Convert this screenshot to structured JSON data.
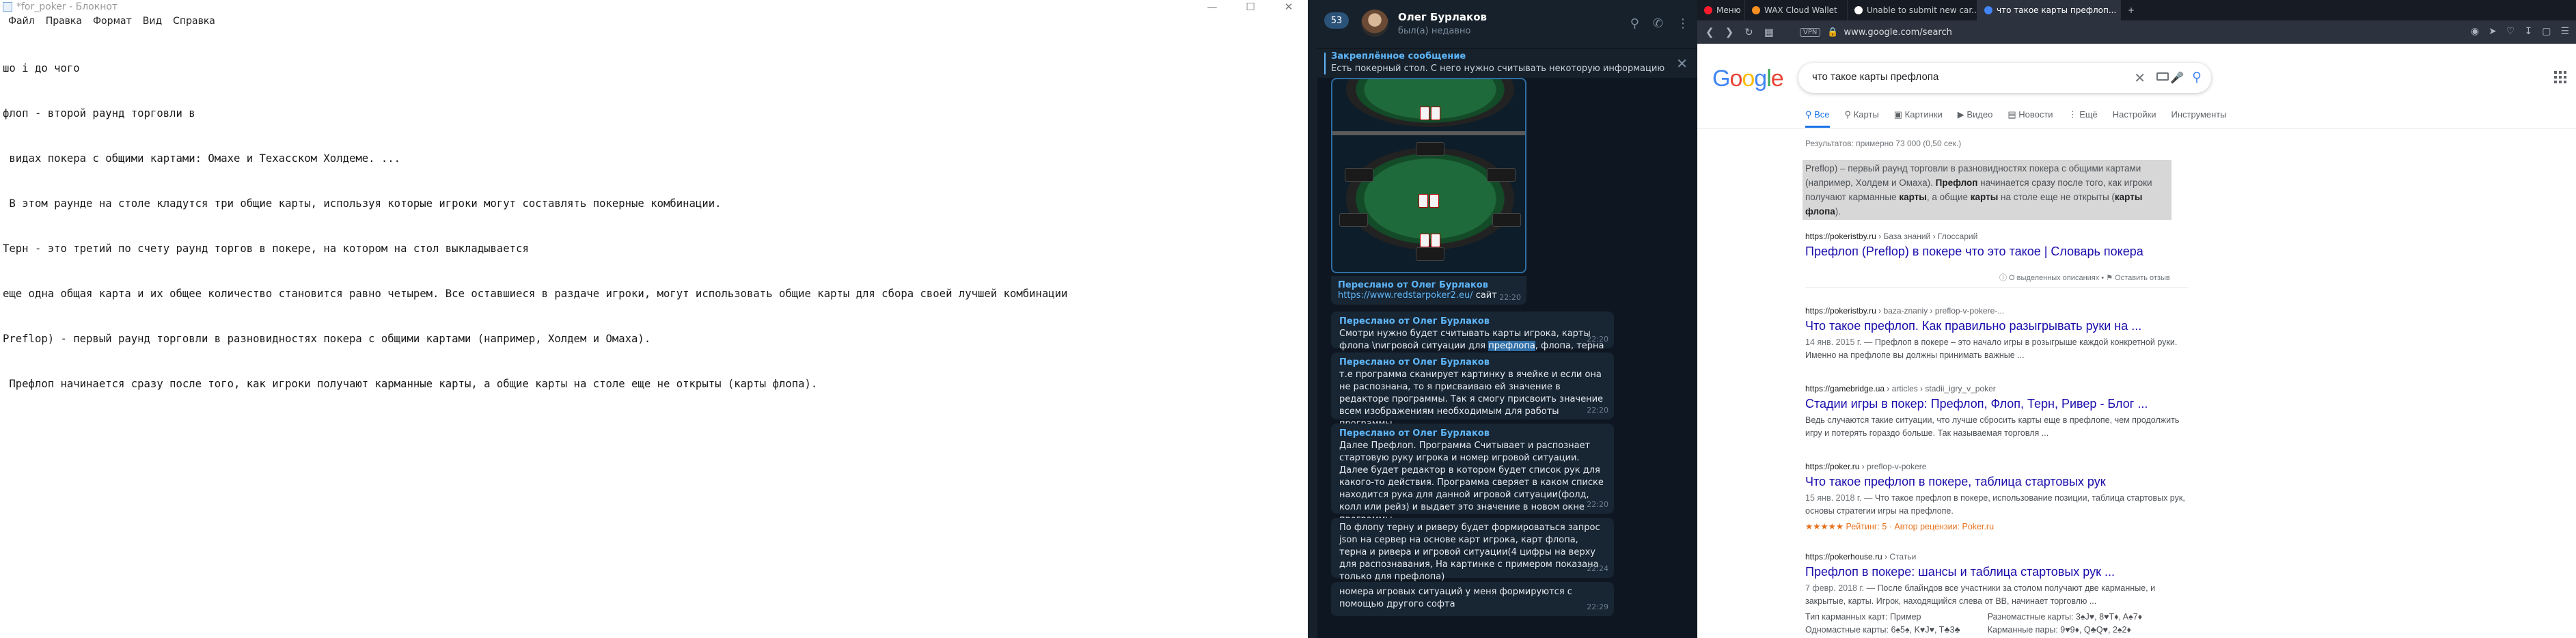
{
  "notepad": {
    "title": "*for_poker - Блокнот",
    "controls": [
      "—",
      "☐",
      "✕"
    ],
    "menu": [
      "Файл",
      "Правка",
      "Формат",
      "Вид",
      "Справка"
    ],
    "lines": [
      "шо і до чого",
      "флоп - второй раунд торговли в",
      " видах покера с общими картами: Омахе и Техасском Холдеме. ...",
      " В этом раунде на столе кладутся три общие карты, используя которые игроки могут составлять покерные комбинации.",
      "Терн - это третий по счету раунд торгов в покере, на котором на стол выкладывается",
      "еще одна общая карта и их общее количество становится равно четырем. Все оставшиеся в раздаче игроки, могут использовать общие карты для сбора своей лучшей комбинации",
      "Preflop) - первый раунд торговли в разновидностях покера с общими картами (например, Холдем и Омаха).",
      " Префлоп начинается сразу после того, как игроки получают карманные карты, а общие карты на столе еще не открыты (карты флопа)."
    ]
  },
  "telegram": {
    "back_count": "53",
    "contact_name": "Олег Бурлаков",
    "contact_status": "был(а) недавно",
    "header_icons": [
      "search-icon",
      "phone-icon",
      "more-icon"
    ],
    "pinned": {
      "title": "Закреплённое сообщение",
      "text": "Есть покерный стол. С него нужно считывать некоторую информацию"
    },
    "image_caption": {
      "forwarded": "Переслано от Олег Бурлаков",
      "link": "https://www.redstarpoker2.eu/",
      "suffix": " сайт",
      "time": "22:20"
    },
    "messages": [
      {
        "forwarded": "Переслано от Олег Бурлаков",
        "pre": "Смотри нужно будет считывать карты игрока, карты флопа \\nигровой ситуации для ",
        "highlight": "префлопа",
        "post": ", флопа, терна и ривера",
        "time": "22:20"
      },
      {
        "forwarded": "Переслано от Олег Бурлаков",
        "text": "т.е программа сканирует картинку в ячейке и если она не распознана, то я присваиваю ей значение в редакторе программы. Так я смогу присвоить значение всем изображениям необходимым для работы программы.",
        "time": "22:20"
      },
      {
        "forwarded": "Переслано от Олег Бурлаков",
        "text": "Далее Префлоп. Программа Считывает и распознает стартовую руку игрока и номер игровой ситуации. Далее будет редактор в котором будет список рук для какого-то действия. Программа сверяет в каком списке находится рука для данной игровой ситуации(фолд, колл или рейз) и выдает это значение в новом окне программы.",
        "time": "22:20"
      },
      {
        "text": "По флопу терну и риверу будет формироваться запрос json на сервер на основе карт игрока, карт флопа, терна и ривера и игровой ситуации(4 цифры на верху для распознавания, На картинке с примером показана только для префлопа)",
        "time": "22:24"
      },
      {
        "text": "номера игровых ситуаций у меня формируются с помощью другого софта",
        "time": "22:29"
      }
    ]
  },
  "browser": {
    "tabs": [
      {
        "label": "Меню",
        "icon_color": "#ff1b2d"
      },
      {
        "label": "WAX Cloud Wallet",
        "icon_color": "#f89022"
      },
      {
        "label": "Unable to submit new car...",
        "icon_color": "#ffffff"
      },
      {
        "label": "что такое карты префлоп...",
        "icon_color": "#4285f4"
      }
    ],
    "new_tab": "+",
    "url": "www.google.com/search",
    "vpn_label": "VPN",
    "google": {
      "logo_letters": [
        {
          "ch": "G",
          "color": "#4285f4"
        },
        {
          "ch": "o",
          "color": "#ea4335"
        },
        {
          "ch": "o",
          "color": "#fbbc05"
        },
        {
          "ch": "g",
          "color": "#4285f4"
        },
        {
          "ch": "l",
          "color": "#34a853"
        },
        {
          "ch": "e",
          "color": "#ea4335"
        }
      ],
      "query": "что такое карты префлопа",
      "tabs": [
        "Все",
        "Карты",
        "Картинки",
        "Видео",
        "Новости",
        "Ещё",
        "Настройки",
        "Инструменты"
      ],
      "stats": "Результатов: примерно 73 000 (0,50 сек.)",
      "snippet": {
        "p1": "Preflop) – первый раунд торговли в разновидностях покера с общими картами (например, Холдем и Омаха). ",
        "b1": "Префлоп",
        "p2": " начинается сразу после того, как игроки получают карманные ",
        "b2": "карты",
        "p3": ", а общие ",
        "b3": "карты",
        "p4": " на столе еще не открыты (",
        "b4": "карты флопа",
        "p5": ")."
      },
      "featured": {
        "cite": "https://pokeristby.ru",
        "crumbs": " › База знаний › Глоссарий",
        "title": "Префлоп (Preflop) в покере что это такое | Словарь покера"
      },
      "feedback": "ⓘ О выделенных описаниях  •  ⚑ Оставить отзыв",
      "results": [
        {
          "cite": "https://pokeristby.ru",
          "crumbs": " › baza-znaniy › preflop-v-pokere-...",
          "title": "Что такое префлоп. Как правильно разыгрывать руки на ...",
          "date": "14 янв. 2015 г. — ",
          "desc": "Префлоп в покере – это начало игры в розыгрыше каждой конкретной руки. Именно на префлопе вы должны принимать важные ..."
        },
        {
          "cite": "https://gamebridge.ua",
          "crumbs": " › articles › stadii_igry_v_poker",
          "title": "Стадии игры в покер: Префлоп, Флоп, Терн, Ривер - Блог ...",
          "date": "",
          "desc": "Ведь случаются такие ситуации, что лучше сбросить карты еще в префлопе, чем продолжить игру и потерять гораздо больше. Так называемая торговля ..."
        },
        {
          "cite": "https://poker.ru",
          "crumbs": " › preflop-v-pokere",
          "title": "Что такое префлоп в покере, таблица стартовых рук",
          "date": "15 янв. 2018 г. — ",
          "desc": "Что такое префлоп в покере, использование позиции, таблица стартовых рук, основы стратегии игры на префлопе.",
          "rating": "★★★★★ Рейтинг: 5 · Автор рецензии: Poker.ru"
        },
        {
          "cite": "https://pokerhouse.ru",
          "crumbs": " › Статьи",
          "title": "Префлоп в покере: шансы и таблица стартовых рук ...",
          "date": "7 февр. 2018 г. — ",
          "desc": "После блайндов все участники за столом получают две карманные, и закрытые, карты. Игрок, находящийся слева от BB, начинает торговлю ..."
        }
      ],
      "table": {
        "col1": [
          "Тип карманных карт: Пример",
          "Одномастные карты: 6♠5♠, K♥J♥, T♣3♣"
        ],
        "col2": [
          "Разномастные карты: 3♠J♥, 8♥T♦, A♠7♦",
          "Карманные пары: 9♥9♦, Q♣Q♥, 2♠2♦"
        ]
      }
    }
  }
}
